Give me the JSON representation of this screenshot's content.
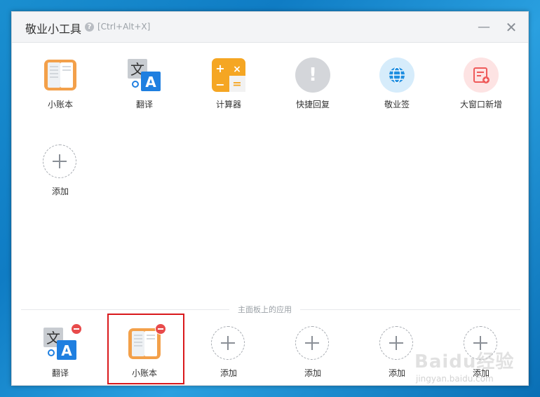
{
  "window": {
    "title": "敬业小工具",
    "shortcut": "[Ctrl+Alt+X]"
  },
  "tools": [
    {
      "label": "小账本",
      "icon": "ledger-book-icon"
    },
    {
      "label": "翻译",
      "icon": "translate-icon"
    },
    {
      "label": "计算器",
      "icon": "calculator-icon"
    },
    {
      "label": "快捷回复",
      "icon": "exclamation-icon"
    },
    {
      "label": "敬业签",
      "icon": "globe-icon"
    },
    {
      "label": "大窗口新增",
      "icon": "note-add-icon"
    },
    {
      "label": "添加",
      "icon": "plus-icon"
    }
  ],
  "panel": {
    "section_label": "主面板上的应用",
    "items": [
      {
        "label": "翻译",
        "icon": "translate-icon"
      },
      {
        "label": "小账本",
        "icon": "ledger-book-icon"
      },
      {
        "label": "添加",
        "icon": "plus-icon"
      },
      {
        "label": "添加",
        "icon": "plus-icon"
      },
      {
        "label": "添加",
        "icon": "plus-icon"
      },
      {
        "label": "添加",
        "icon": "plus-icon"
      }
    ]
  },
  "watermark": {
    "logo": "Baidu经验",
    "url": "jingyan.baidu.com"
  },
  "colors": {
    "accent_orange": "#f3a04a",
    "accent_blue": "#1f7fe0",
    "badge_red": "#e84b4b",
    "highlight_red": "#d9191c"
  }
}
